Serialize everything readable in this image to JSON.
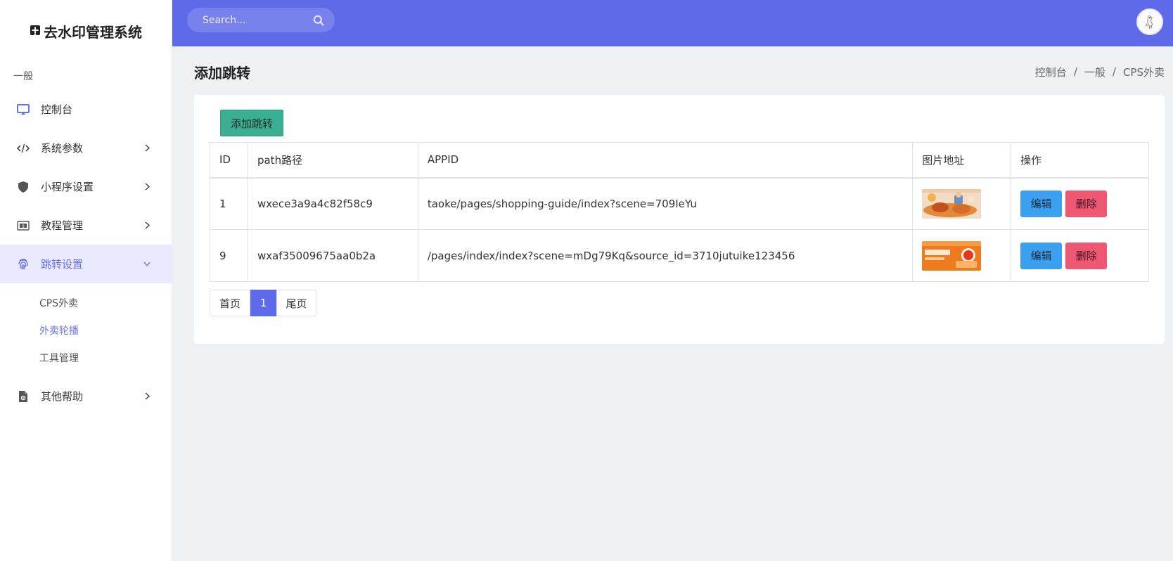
{
  "app": {
    "brand_title": "去水印管理系统"
  },
  "sidebar": {
    "section_label": "一般",
    "items": [
      {
        "label": "控制台",
        "icon": "monitor-icon",
        "has_chevron": false
      },
      {
        "label": "系统参数",
        "icon": "code-icon",
        "has_chevron": true
      },
      {
        "label": "小程序设置",
        "icon": "shield-icon",
        "has_chevron": true
      },
      {
        "label": "教程管理",
        "icon": "dollar-card-icon",
        "has_chevron": true
      },
      {
        "label": "跳转设置",
        "icon": "fingerprint-icon",
        "has_chevron": true,
        "active": true
      },
      {
        "label": "其他帮助",
        "icon": "file-gear-icon",
        "has_chevron": true
      }
    ],
    "submenu": [
      {
        "label": "CPS外卖"
      },
      {
        "label": "外卖轮播",
        "active": true
      },
      {
        "label": "工具管理"
      }
    ]
  },
  "topbar": {
    "search_placeholder": "Search..."
  },
  "page": {
    "title": "添加跳转",
    "breadcrumb": [
      "控制台",
      "一般",
      "CPS外卖"
    ],
    "breadcrumb_sep": "/"
  },
  "card": {
    "add_button": "添加跳转",
    "table": {
      "headers": [
        "ID",
        "path路径",
        "APPID",
        "图片地址",
        "操作"
      ],
      "rows": [
        {
          "id": "1",
          "path": "wxece3a9a4c82f58c9",
          "appid": "taoke/pages/shopping-guide/index?scene=709IeYu",
          "image": "food-banner-thumbnail",
          "edit": "编辑",
          "delete": "删除"
        },
        {
          "id": "9",
          "path": "wxaf35009675aa0b2a",
          "appid": "/pages/index/index?scene=mDg79Kq&source_id=3710jutuike123456",
          "image": "orange-promo-thumbnail",
          "edit": "编辑",
          "delete": "删除"
        }
      ]
    },
    "pager": {
      "first": "首页",
      "current": "1",
      "last": "尾页"
    }
  },
  "colors": {
    "topbar": "#5f6ae9",
    "accent": "#6772e5",
    "add_button": "#3aaf92",
    "edit_button": "#3ba0ef",
    "delete_button": "#ee5873"
  }
}
